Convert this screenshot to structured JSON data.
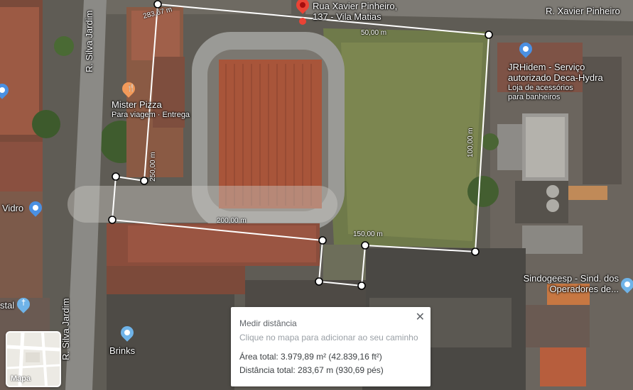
{
  "roads": {
    "xavier_pinheiro": "R. Xavier Pinheiro",
    "silva_jardim_top": "R. Silva Jardim",
    "silva_jardim_bottom": "R. Silva Jardim"
  },
  "main_pin": {
    "line1": "Rua Xavier Pinheiro,",
    "line2": "137 - Vila Matias",
    "color": "#ea4335"
  },
  "places": {
    "mister_pizza": {
      "name": "Mister Pizza",
      "sub": "Para viagem · Entrega",
      "color": "#f29a5a"
    },
    "jrhidem": {
      "name1": "JRHidem - Serviço",
      "name2": "autorizado Deca-Hydra",
      "sub1": "Loja de acessórios",
      "sub2": "para banheiros",
      "color": "#4a90e2"
    },
    "vidro": {
      "name": "Vidro",
      "color": "#4a90e2"
    },
    "stal": {
      "name": "stal",
      "color": "#6fb3e8"
    },
    "sindogeesp": {
      "name1": "Sindogeesp - Sind. dos",
      "name2": "Operadores de...",
      "color": "#6fb3e8"
    },
    "brinks": {
      "name": "Brinks",
      "color": "#6fb3e8"
    }
  },
  "measurements": {
    "seg1": "283,67 m",
    "seg2": "50,00 m",
    "seg3": "100,00 m",
    "seg4": "150,00 m",
    "seg5": "200,00 m",
    "seg6": "250,00 m"
  },
  "popup": {
    "title": "Medir distância",
    "hint": "Clique no mapa para adicionar ao seu caminho",
    "area": "Área total: 3.979,89 m² (42.839,16 ft²)",
    "distance": "Distância total: 283,67 m (930,69 pés)",
    "close": "✕"
  },
  "minimap": {
    "label": "Mapa"
  }
}
